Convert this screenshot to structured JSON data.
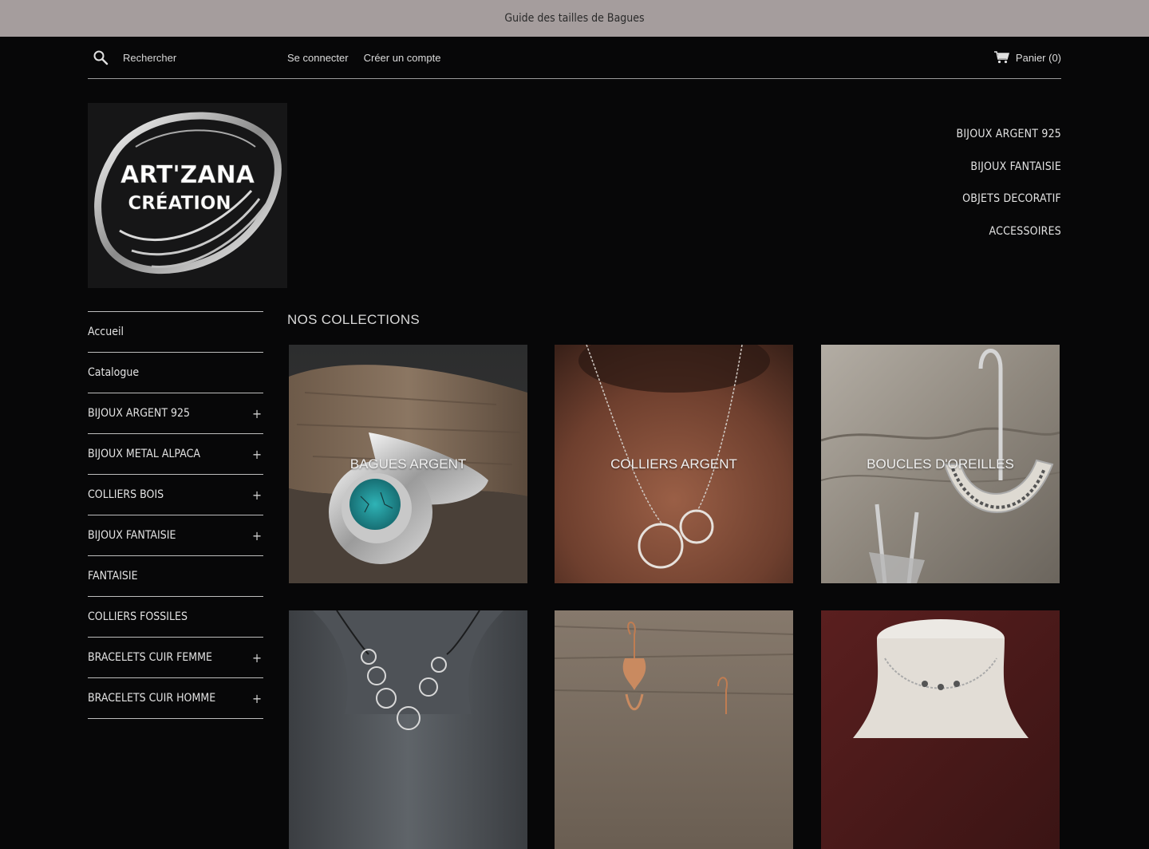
{
  "announcement": "Guide des tailles de Bagues",
  "header": {
    "search_placeholder": "Rechercher",
    "login": "Se connecter",
    "register": "Créer un compte",
    "cart": "Panier (0)"
  },
  "logo": {
    "line1": "ART'ZANA",
    "line2": "CRÉATION"
  },
  "top_nav": [
    "BIJOUX ARGENT 925",
    "BIJOUX FANTAISIE",
    "OBJETS DECORATIF",
    "ACCESSOIRES"
  ],
  "side_nav": [
    {
      "label": "Accueil",
      "expandable": false
    },
    {
      "label": "Catalogue",
      "expandable": false
    },
    {
      "label": "BIJOUX ARGENT 925",
      "expandable": true
    },
    {
      "label": "BIJOUX METAL ALPACA",
      "expandable": true
    },
    {
      "label": "COLLIERS BOIS",
      "expandable": true
    },
    {
      "label": "BIJOUX FANTAISIE",
      "expandable": true
    },
    {
      "label": "FANTAISIE",
      "expandable": false
    },
    {
      "label": "COLLIERS FOSSILES",
      "expandable": false
    },
    {
      "label": "BRACELETS CUIR FEMME",
      "expandable": true
    },
    {
      "label": "BRACELETS CUIR HOMME",
      "expandable": true
    }
  ],
  "plus_symbol": "+",
  "collections_title": "NOS COLLECTIONS",
  "collections": [
    {
      "label": "BAGUES ARGENT",
      "image": "turquoise-ring"
    },
    {
      "label": "COLLIERS ARGENT",
      "image": "circle-necklace"
    },
    {
      "label": "BOUCLES D'OREILLES",
      "image": "silver-earrings"
    },
    {
      "label": "",
      "image": "rings-necklace"
    },
    {
      "label": "",
      "image": "copper-earrings"
    },
    {
      "label": "",
      "image": "bust-necklace"
    }
  ],
  "colors": {
    "background": "#070708",
    "announcement_bar": "#a59d9d",
    "text": "#e2e2e2"
  }
}
